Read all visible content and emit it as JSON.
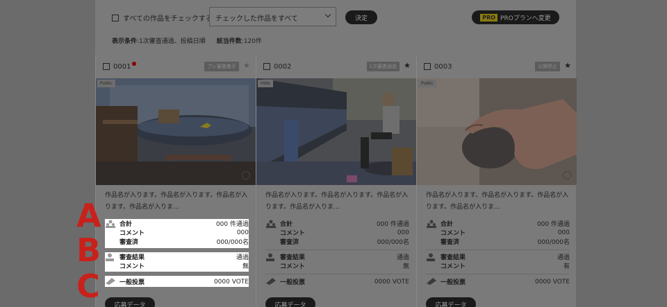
{
  "toolbar": {
    "check_all_label": "すべての作品をチェックする",
    "bulk_select_value": "チェックした作品をすべて",
    "decide_label": "決定",
    "pro_tag": "PRO",
    "pro_label": "PROプランへ変更"
  },
  "conditions": {
    "filter_label": "表示条件",
    "filter_value": ":1次審査通過、投稿日順",
    "count_label": "該当件数",
    "count_value": ":120件"
  },
  "cards": [
    {
      "id": "0001",
      "status": "プレ審査着手",
      "visibility": "Public",
      "description": "作品名が入ります。作品名が入ります。作品名が入ります。作品名が入りま...",
      "total_label": "合計",
      "total_value": "000 件通過",
      "comment_label": "コメント",
      "comment_value": "000",
      "reviewed_label": "審査済",
      "reviewed_value": "000/000名",
      "result_label": "審査結果",
      "result_value": "通過",
      "result_comment_label": "コメント",
      "result_comment_value": "無",
      "vote_label": "一般投票",
      "vote_value": "0000 VOTE",
      "apply_label": "応募データ"
    },
    {
      "id": "0002",
      "status": "1次審査通過",
      "visibility": "Hide",
      "description": "作品名が入ります。作品名が入ります。作品名が入ります。作品名が入りま...",
      "total_label": "合計",
      "total_value": "000 件通過",
      "comment_label": "コメント",
      "comment_value": "000",
      "reviewed_label": "審査済",
      "reviewed_value": "000/000名",
      "result_label": "審査結果",
      "result_value": "通過",
      "result_comment_label": "コメント",
      "result_comment_value": "無",
      "vote_label": "一般投票",
      "vote_value": "0000 VOTE",
      "apply_label": "応募データ"
    },
    {
      "id": "0003",
      "status": "公開停止",
      "visibility": "Public",
      "description": "作品名が入ります。作品名が入ります。作品名が入ります。作品名が入りま...",
      "total_label": "合計",
      "total_value": "000 件通過",
      "comment_label": "コメント",
      "comment_value": "000",
      "reviewed_label": "審査済",
      "reviewed_value": "000/000名",
      "result_label": "審査結果",
      "result_value": "通過",
      "result_comment_label": "コメント",
      "result_comment_value": "有",
      "vote_label": "一般投票",
      "vote_value": "0000 VOTE",
      "apply_label": "応募データ"
    }
  ],
  "annotations": [
    "A",
    "B",
    "C"
  ],
  "colors": {
    "highlight": "#ffffff",
    "annotation": "#c8211b",
    "overlay": "#7a7a7a"
  }
}
